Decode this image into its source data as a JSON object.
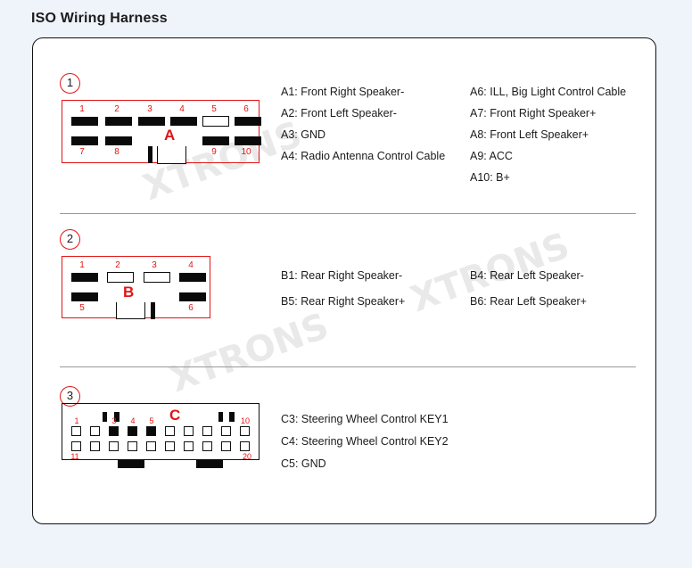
{
  "page": {
    "title": "ISO Wiring Harness",
    "background_color": "#eff4fa",
    "card_color": "#ffffff",
    "accent_color": "#e11515",
    "text_color": "#1b1b1b",
    "watermark_text": "XTRONS"
  },
  "sections": [
    {
      "badge": "1",
      "group_letter": "A",
      "connector": {
        "name": "connector-a",
        "border_color": "#e11515",
        "top_pins": [
          {
            "number": "1",
            "state": "filled"
          },
          {
            "number": "2",
            "state": "filled"
          },
          {
            "number": "3",
            "state": "filled"
          },
          {
            "number": "4",
            "state": "filled"
          },
          {
            "number": "5",
            "state": "empty"
          },
          {
            "number": "6",
            "state": "filled"
          }
        ],
        "bottom_pins": [
          {
            "number": "7",
            "state": "filled"
          },
          {
            "number": "8",
            "state": "filled"
          },
          {
            "number": "9",
            "state": "filled"
          },
          {
            "number": "10",
            "state": "filled"
          }
        ]
      },
      "descriptions_left": [
        "A1: Front Right Speaker-",
        "A2: Front Left Speaker-",
        "A3: GND",
        "A4: Radio Antenna Control Cable"
      ],
      "descriptions_right": [
        "A6: ILL, Big Light Control Cable",
        "A7: Front Right Speaker+",
        "A8: Front Left Speaker+",
        "A9: ACC",
        "A10: B+"
      ]
    },
    {
      "badge": "2",
      "group_letter": "B",
      "connector": {
        "name": "connector-b",
        "border_color": "#e11515",
        "top_pins": [
          {
            "number": "1",
            "state": "filled"
          },
          {
            "number": "2",
            "state": "empty"
          },
          {
            "number": "3",
            "state": "empty"
          },
          {
            "number": "4",
            "state": "filled"
          }
        ],
        "bottom_pins": [
          {
            "number": "5",
            "state": "filled"
          },
          {
            "number": "6",
            "state": "filled"
          }
        ]
      },
      "descriptions_left": [
        "B1: Rear Right Speaker-",
        "B5: Rear Right Speaker+"
      ],
      "descriptions_right": [
        "B4: Rear Left Speaker-",
        "B6: Rear Left Speaker+"
      ]
    },
    {
      "badge": "3",
      "group_letter": "C",
      "connector": {
        "name": "connector-c",
        "border_color": "#111111",
        "top_pins": [
          {
            "number": "1",
            "state": "empty"
          },
          {
            "number": "",
            "state": "empty"
          },
          {
            "number": "3",
            "state": "filled"
          },
          {
            "number": "4",
            "state": "filled"
          },
          {
            "number": "5",
            "state": "filled"
          },
          {
            "number": "",
            "state": "empty"
          },
          {
            "number": "",
            "state": "empty"
          },
          {
            "number": "",
            "state": "empty"
          },
          {
            "number": "",
            "state": "empty"
          },
          {
            "number": "10",
            "state": "empty"
          }
        ],
        "bottom_pins": [
          {
            "number": "11",
            "state": "empty"
          },
          {
            "number": "",
            "state": "empty"
          },
          {
            "number": "",
            "state": "empty"
          },
          {
            "number": "",
            "state": "empty"
          },
          {
            "number": "",
            "state": "empty"
          },
          {
            "number": "",
            "state": "empty"
          },
          {
            "number": "",
            "state": "empty"
          },
          {
            "number": "",
            "state": "empty"
          },
          {
            "number": "",
            "state": "empty"
          },
          {
            "number": "20",
            "state": "empty"
          }
        ]
      },
      "descriptions_left": [
        "C3: Steering Wheel Control KEY1",
        "C4: Steering Wheel Control KEY2",
        "C5: GND"
      ],
      "descriptions_right": []
    }
  ]
}
